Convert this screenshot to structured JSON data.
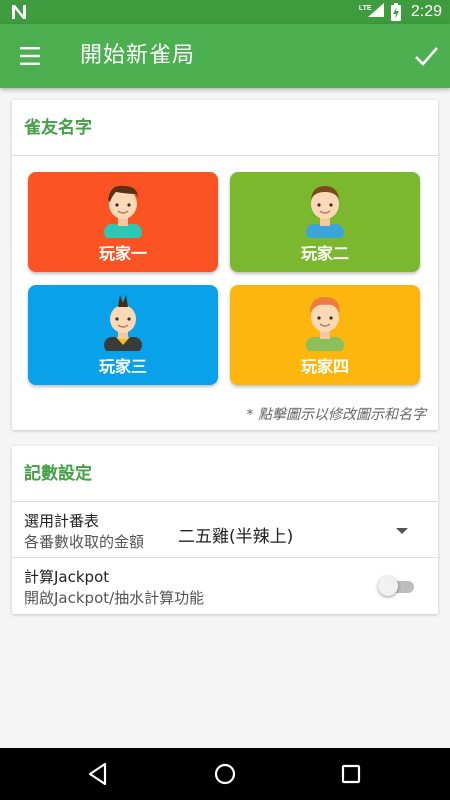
{
  "status_bar": {
    "network": "LTE",
    "time": "2:29"
  },
  "app_bar": {
    "title": "開始新雀局"
  },
  "players_card": {
    "header": "雀友名字",
    "players": [
      {
        "name": "玩家一",
        "color": "#fc5322"
      },
      {
        "name": "玩家二",
        "color": "#7cb82e"
      },
      {
        "name": "玩家三",
        "color": "#08a1ea"
      },
      {
        "name": "玩家四",
        "color": "#fdb60d"
      }
    ],
    "hint": "* 點擊圖示以修改圖示和名字"
  },
  "settings_card": {
    "header": "記數設定",
    "score_table": {
      "label": "選用計番表",
      "sublabel": "各番數收取的金額",
      "selected": "二五雞(半辣上)"
    },
    "jackpot": {
      "label": "計算Jackpot",
      "sublabel": "開啟Jackpot/抽水計算功能",
      "enabled": false
    }
  }
}
